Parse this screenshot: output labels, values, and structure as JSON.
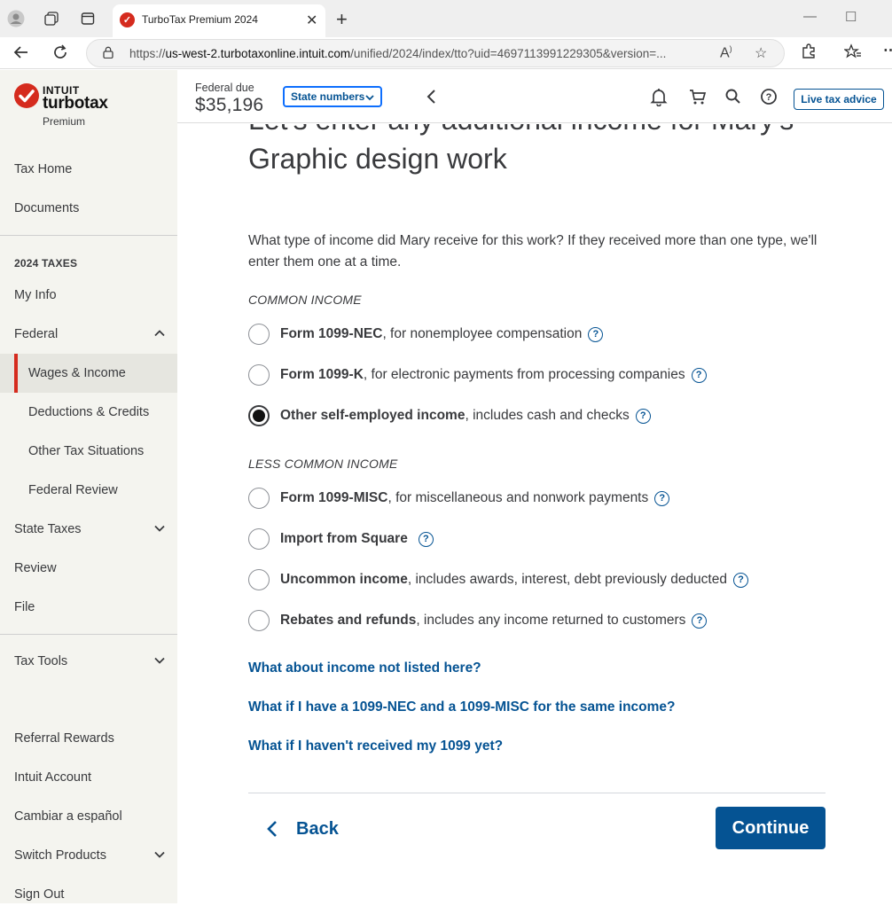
{
  "browser": {
    "tab_title": "TurboTax Premium 2024",
    "url_prefix": "https://",
    "url_host": "us-west-2.turbotaxonline.intuit.com",
    "url_path": "/unified/2024/index/tto?uid=4697113991229305&version=..."
  },
  "brand": {
    "intuit": "INTUIT",
    "turbotax": "turbotax",
    "edition": "Premium"
  },
  "sidebar": {
    "top_items": [
      "Tax Home",
      "Documents"
    ],
    "section_label": "2024 TAXES",
    "my_info": "My Info",
    "federal": "Federal",
    "federal_sub": [
      "Wages & Income",
      "Deductions & Credits",
      "Other Tax Situations",
      "Federal Review"
    ],
    "state_taxes": "State Taxes",
    "review": "Review",
    "file": "File",
    "tax_tools": "Tax Tools",
    "bottom_items": [
      "Referral Rewards",
      "Intuit Account",
      "Cambiar a español"
    ],
    "switch_products": "Switch Products",
    "sign_out": "Sign Out"
  },
  "header": {
    "federal_due_label": "Federal due",
    "federal_due_amount": "$35,196",
    "state_numbers": "State numbers",
    "live_tax_advice": "Live tax advice"
  },
  "main": {
    "heading": "Let's enter any additional income for Mary's Graphic design work",
    "question": "What type of income did Mary receive for this work? If they received more than one type, we'll enter them one at a time.",
    "common_label": "COMMON INCOME",
    "less_common_label": "LESS COMMON INCOME",
    "common_options": [
      {
        "bold": "Form 1099-NEC",
        "rest": ", for nonemployee compensation",
        "selected": false
      },
      {
        "bold": "Form 1099-K",
        "rest": ", for electronic payments from processing companies",
        "selected": false
      },
      {
        "bold": "Other self-employed income",
        "rest": ", includes cash and checks",
        "selected": true
      }
    ],
    "less_common_options": [
      {
        "bold": "Form 1099-MISC",
        "rest": ", for miscellaneous and nonwork payments",
        "selected": false
      },
      {
        "bold": "Import from Square",
        "rest": "",
        "selected": false
      },
      {
        "bold": "Uncommon income",
        "rest": ", includes awards, interest, debt previously deducted",
        "selected": false
      },
      {
        "bold": "Rebates and refunds",
        "rest": ", includes any income returned to customers",
        "selected": false
      }
    ],
    "links": [
      "What about income not listed here?",
      "What if I have a 1099-NEC and a 1099-MISC for the same income?",
      "What if I haven't received my 1099 yet?"
    ],
    "back": "Back",
    "continue": "Continue"
  },
  "colors": {
    "brand_red": "#d52b1e",
    "link_blue": "#055393",
    "sidebar_bg": "#f4f4ef"
  }
}
